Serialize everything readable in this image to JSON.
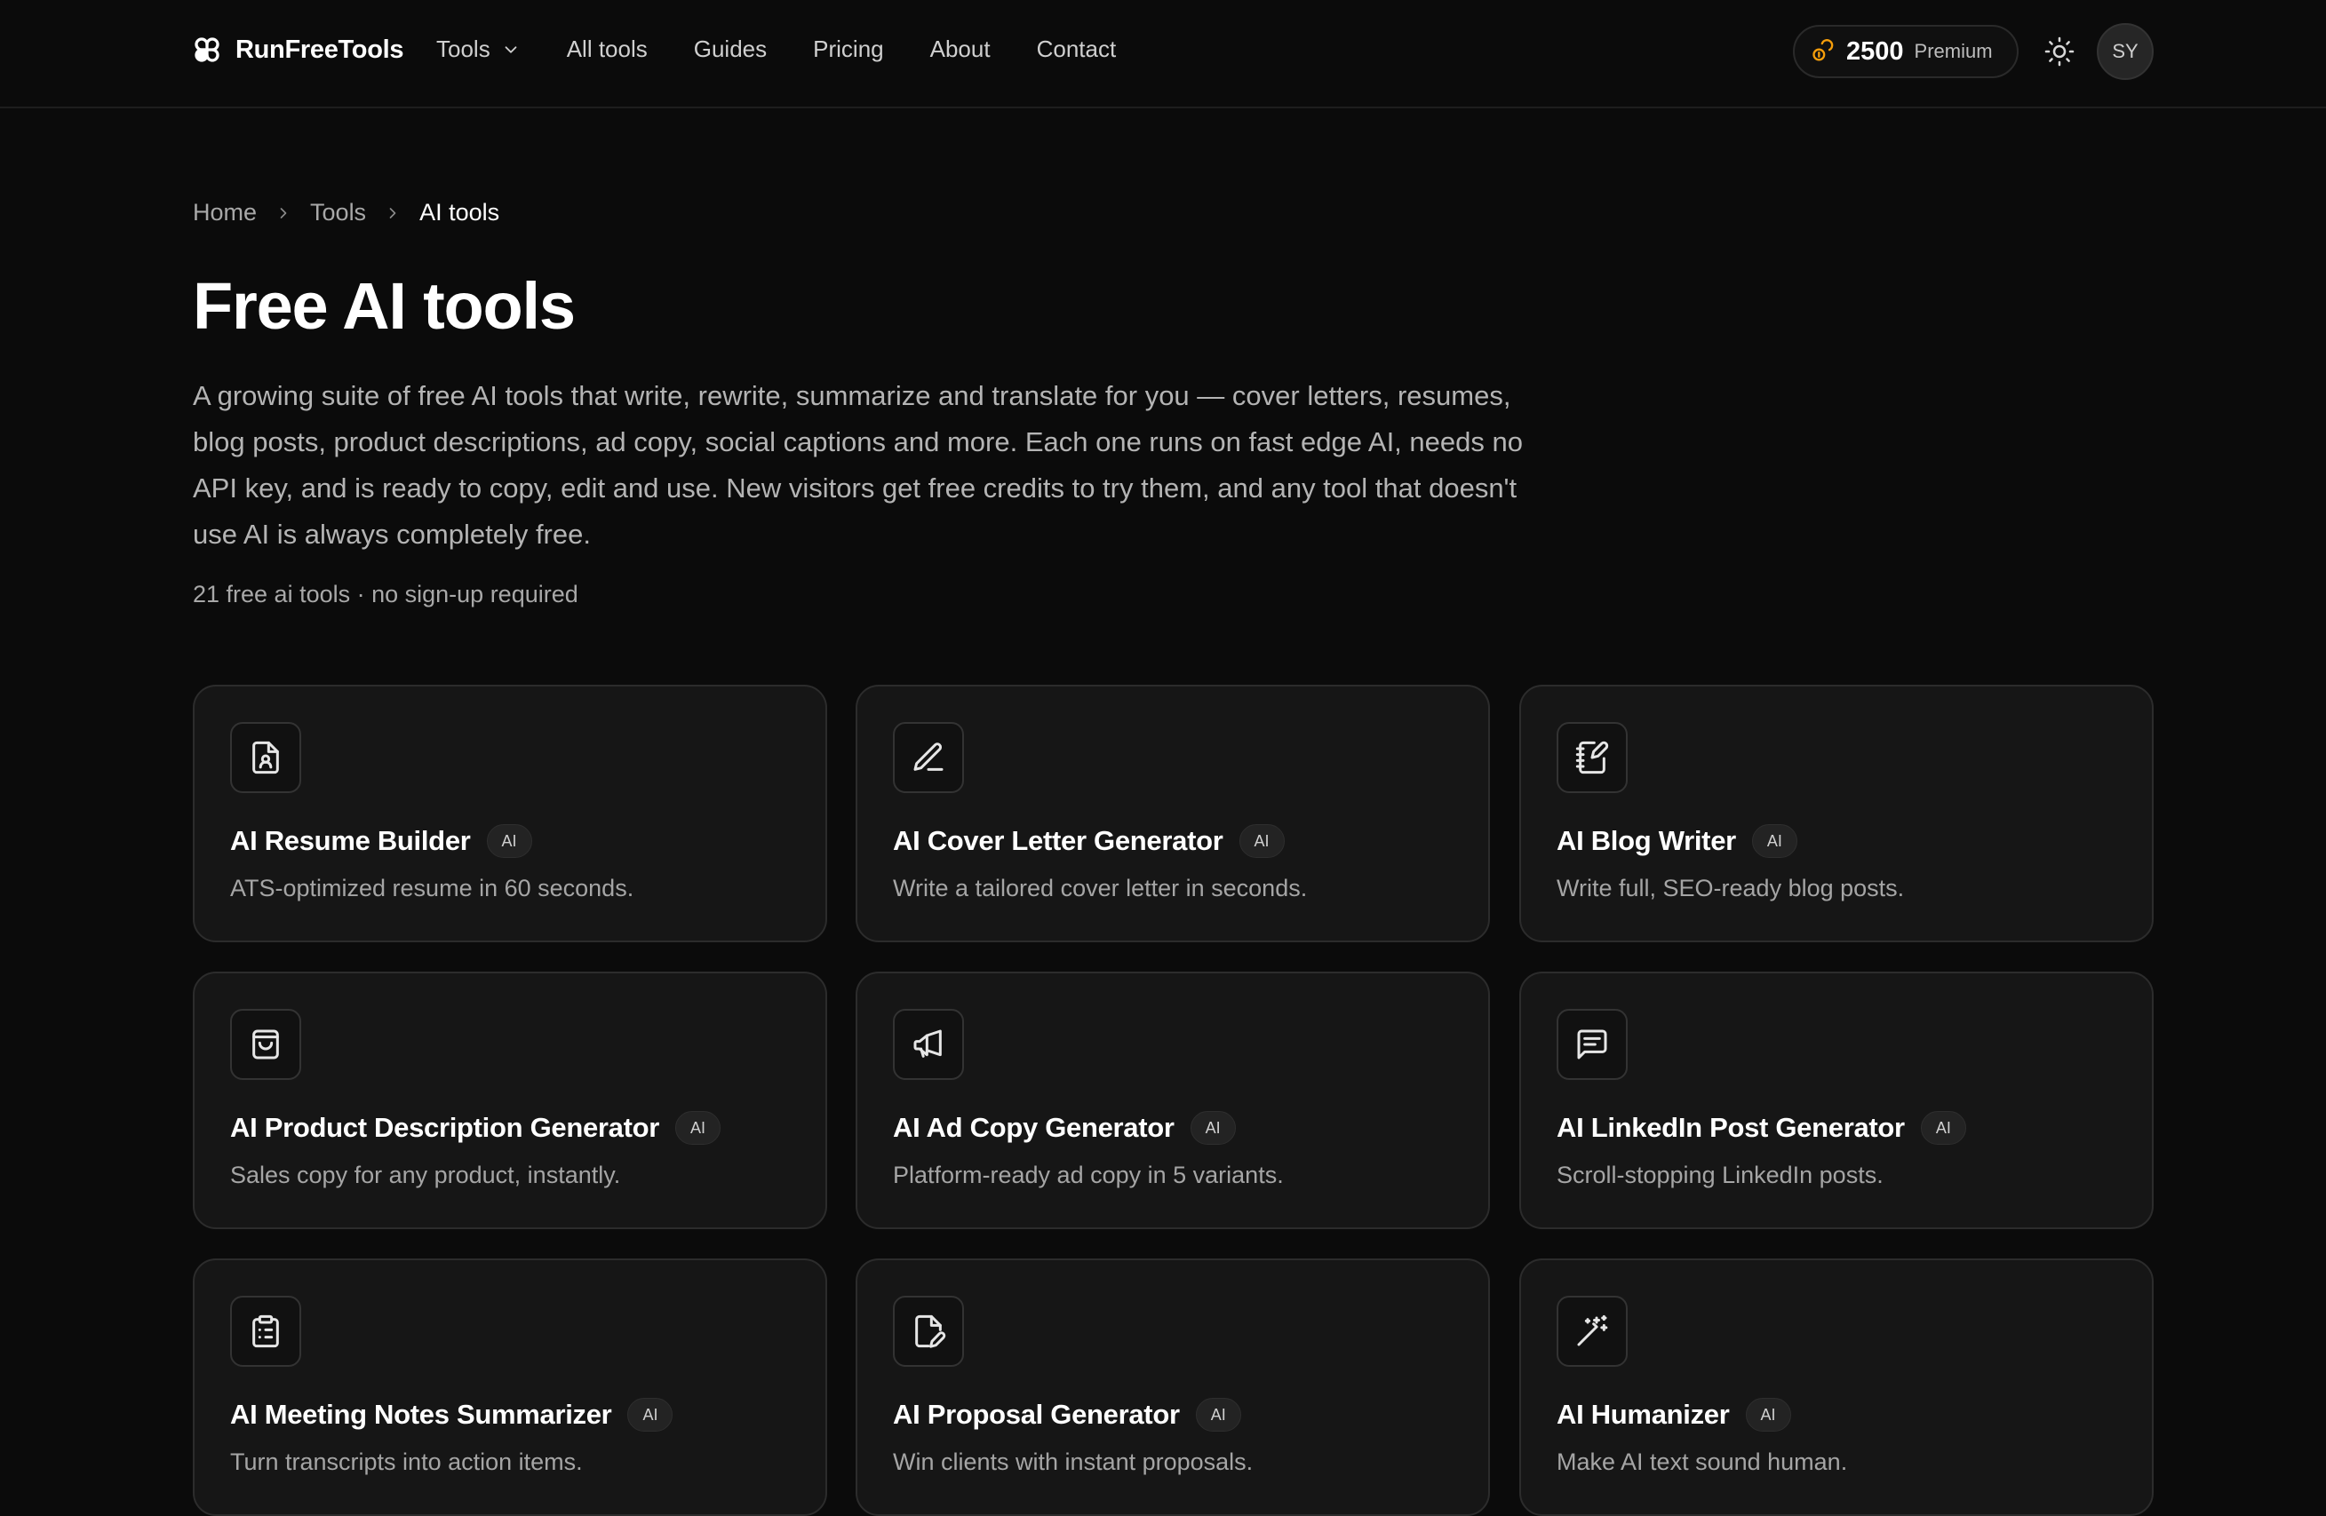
{
  "header": {
    "brand": "RunFreeTools",
    "nav": [
      {
        "label": "Tools",
        "has_dropdown": true
      },
      {
        "label": "All tools"
      },
      {
        "label": "Guides"
      },
      {
        "label": "Pricing"
      },
      {
        "label": "About"
      },
      {
        "label": "Contact"
      }
    ],
    "credits": {
      "amount": "2500",
      "tier": "Premium",
      "icon": "coins-icon",
      "accent": "#f59e0b"
    },
    "theme_icon": "sun-icon",
    "avatar_initials": "SY"
  },
  "breadcrumb": [
    "Home",
    "Tools",
    "AI tools"
  ],
  "page": {
    "title": "Free AI tools",
    "intro": "A growing suite of free AI tools that write, rewrite, summarize and translate for you — cover letters, resumes, blog posts, product descriptions, ad copy, social captions and more. Each one runs on fast edge AI, needs no API key, and is ready to copy, edit and use. New visitors get free credits to try them, and any tool that doesn't use AI is always completely free.",
    "meta": "21 free ai tools · no sign-up required"
  },
  "tools": [
    {
      "title": "AI Resume Builder",
      "badge": "AI",
      "desc": "ATS-optimized resume in 60 seconds.",
      "icon": "resume-icon"
    },
    {
      "title": "AI Cover Letter Generator",
      "badge": "AI",
      "desc": "Write a tailored cover letter in seconds.",
      "icon": "pen-icon"
    },
    {
      "title": "AI Blog Writer",
      "badge": "AI",
      "desc": "Write full, SEO-ready blog posts.",
      "icon": "notebook-pen-icon"
    },
    {
      "title": "AI Product Description Generator",
      "badge": "AI",
      "desc": "Sales copy for any product, instantly.",
      "icon": "shopping-bag-icon"
    },
    {
      "title": "AI Ad Copy Generator",
      "badge": "AI",
      "desc": "Platform-ready ad copy in 5 variants.",
      "icon": "megaphone-icon"
    },
    {
      "title": "AI LinkedIn Post Generator",
      "badge": "AI",
      "desc": "Scroll-stopping LinkedIn posts.",
      "icon": "message-square-text-icon"
    },
    {
      "title": "AI Meeting Notes Summarizer",
      "badge": "AI",
      "desc": "Turn transcripts into action items.",
      "icon": "clipboard-list-icon"
    },
    {
      "title": "AI Proposal Generator",
      "badge": "AI",
      "desc": "Win clients with instant proposals.",
      "icon": "file-pen-icon"
    },
    {
      "title": "AI Humanizer",
      "badge": "AI",
      "desc": "Make AI text sound human.",
      "icon": "magic-wand-icon"
    }
  ]
}
